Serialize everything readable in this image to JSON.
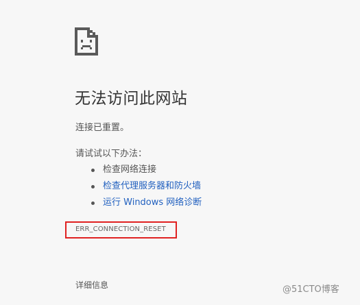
{
  "icon": "sad-page-icon",
  "title": "无法访问此网站",
  "subtitle": "连接已重置。",
  "suggestions": {
    "heading": "请试试以下办法：",
    "items": [
      {
        "label": "检查网络连接"
      },
      {
        "label": "检查代理服务器和防火墙"
      },
      {
        "label": "运行 Windows 网络诊断"
      }
    ]
  },
  "error_code": "ERR_CONNECTION_RESET",
  "details_button": "详细信息",
  "watermark": "@51CTO博客",
  "colors": {
    "background": "#f7f7f7",
    "text": "#333333",
    "link": "#2160bf",
    "highlight_border": "#e02020"
  }
}
